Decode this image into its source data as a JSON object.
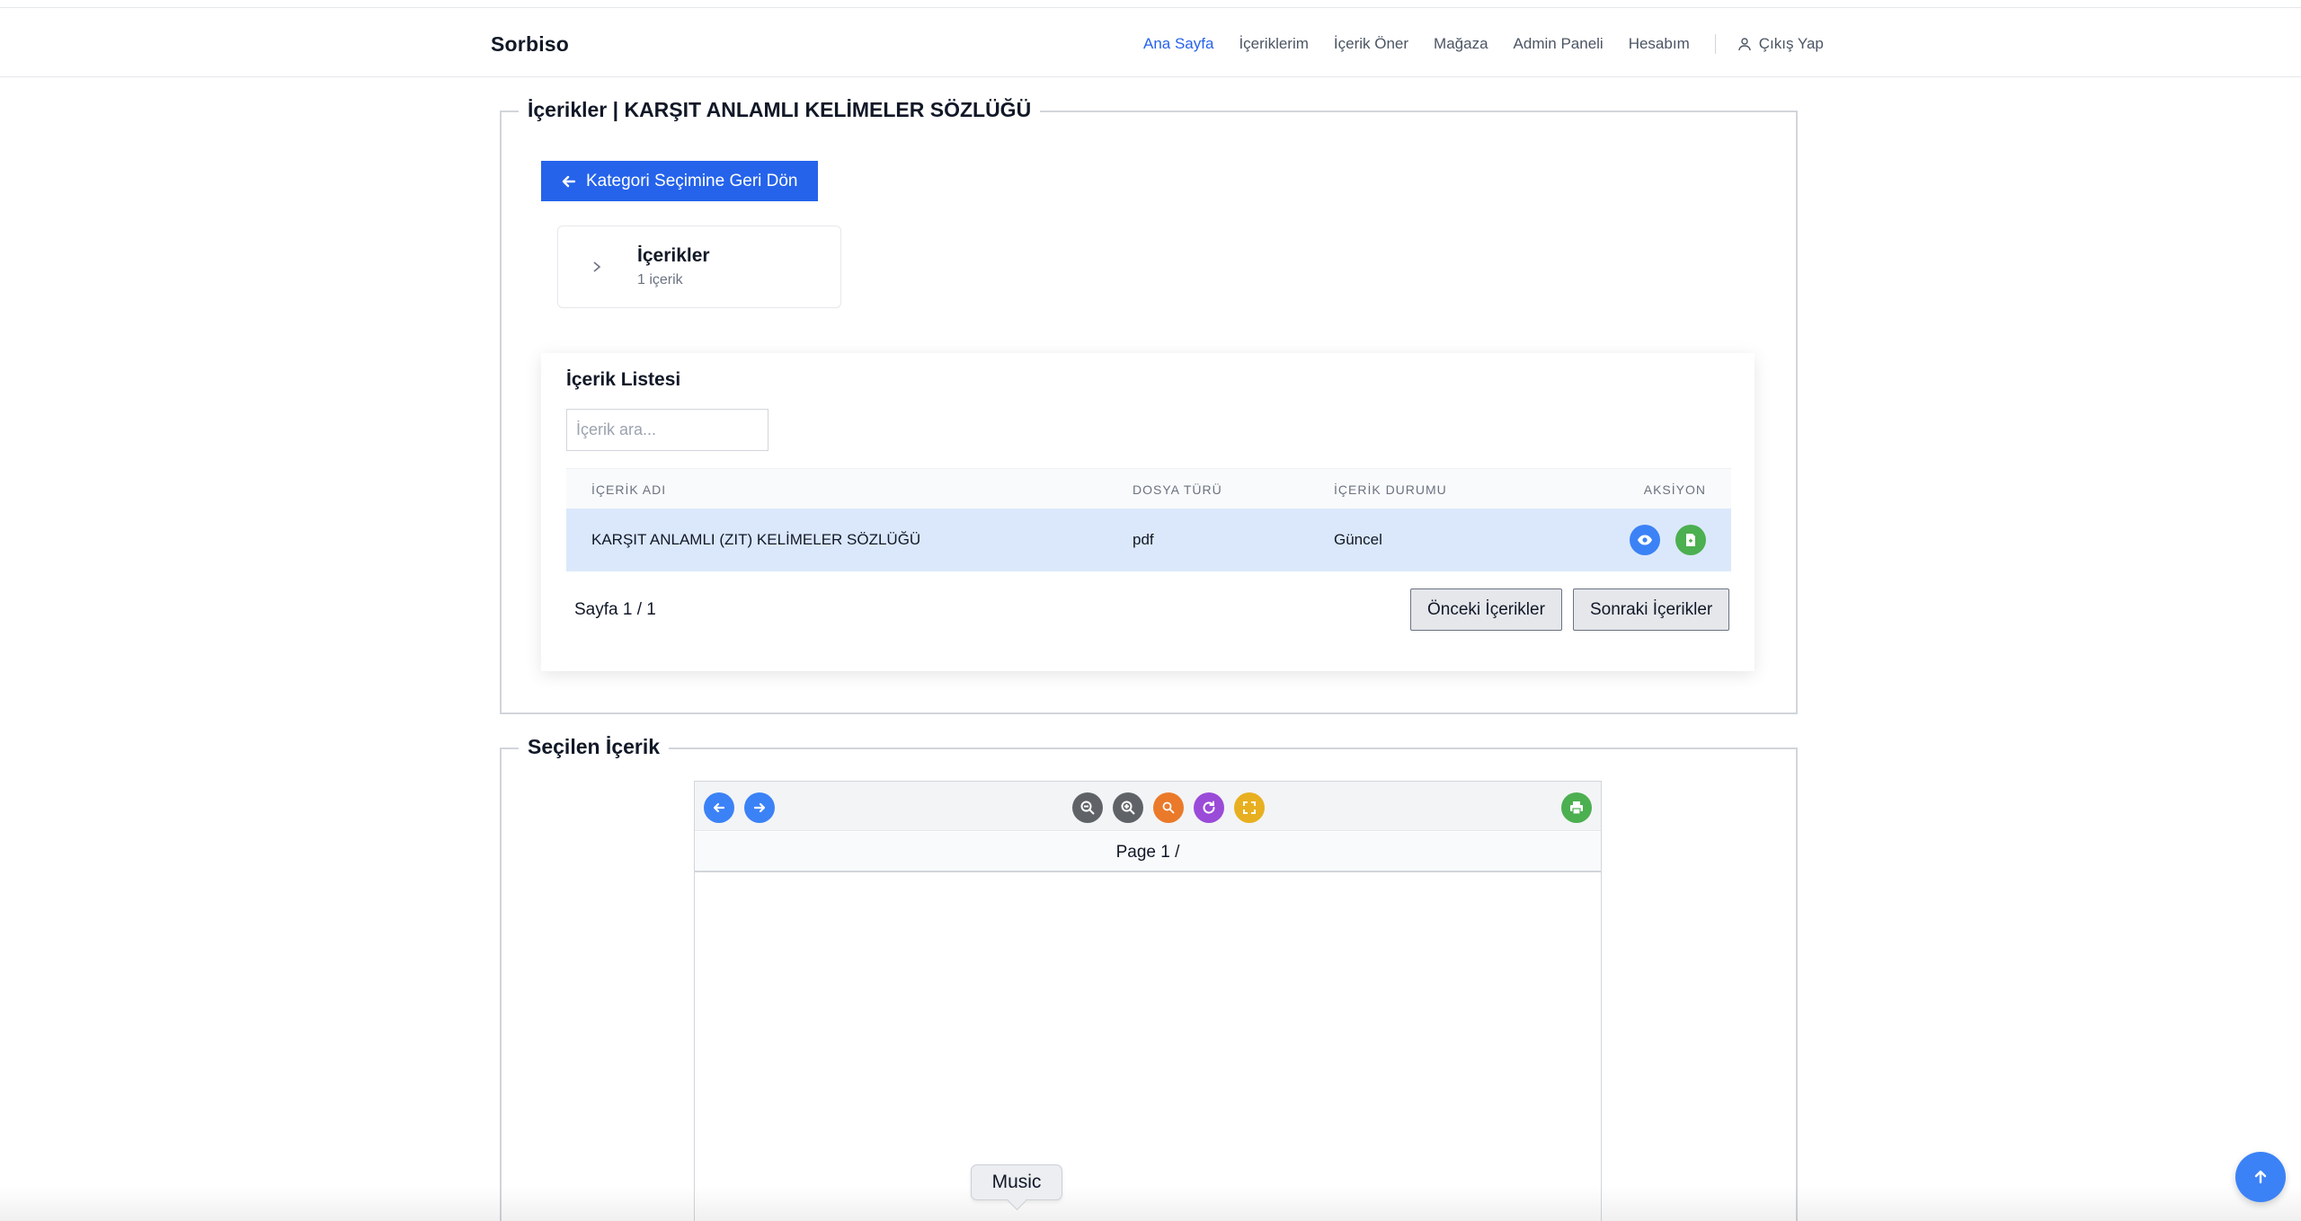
{
  "header": {
    "brand": "Sorbiso",
    "nav": [
      "Ana Sayfa",
      "İçeriklerim",
      "İçerik Öner",
      "Mağaza",
      "Admin Paneli",
      "Hesabım"
    ],
    "logout": "Çıkış Yap"
  },
  "contents_section": {
    "legend": "İçerikler | KARŞIT ANLAMLI KELİMELER SÖZLÜĞÜ",
    "back_button": "Kategori Seçimine Geri Dön",
    "category": {
      "title": "İçerikler",
      "count": "1 içerik"
    },
    "list": {
      "title": "İçerik Listesi",
      "search_placeholder": "İçerik ara...",
      "columns": [
        "İÇERİK ADI",
        "DOSYA TÜRÜ",
        "İÇERİK DURUMU",
        "AKSİYON"
      ],
      "rows": [
        {
          "name": "KARŞIT ANLAMLI (ZIT) KELİMELER SÖZLÜĞÜ",
          "type": "pdf",
          "status": "Güncel"
        }
      ],
      "page_info": "Sayfa 1 / 1",
      "prev_button": "Önceki İçerikler",
      "next_button": "Sonraki İçerikler"
    }
  },
  "selected_section": {
    "legend": "Seçilen İçerik",
    "viewer": {
      "page_label": "Page 1 /",
      "toolbar_icons": [
        "arrow-left-icon",
        "arrow-right-icon",
        "zoom-out-icon",
        "zoom-in-icon",
        "reset-zoom-icon",
        "rotate-icon",
        "fullscreen-icon",
        "print-icon"
      ]
    }
  },
  "tooltip": "Music",
  "colors": {
    "primary": "#2563eb",
    "selected_row": "#dbe8fb",
    "green": "#4caf50",
    "orange": "#ea7a2a",
    "purple": "#9a4bd8",
    "yellow": "#e8b020",
    "gray": "#5f6368"
  }
}
